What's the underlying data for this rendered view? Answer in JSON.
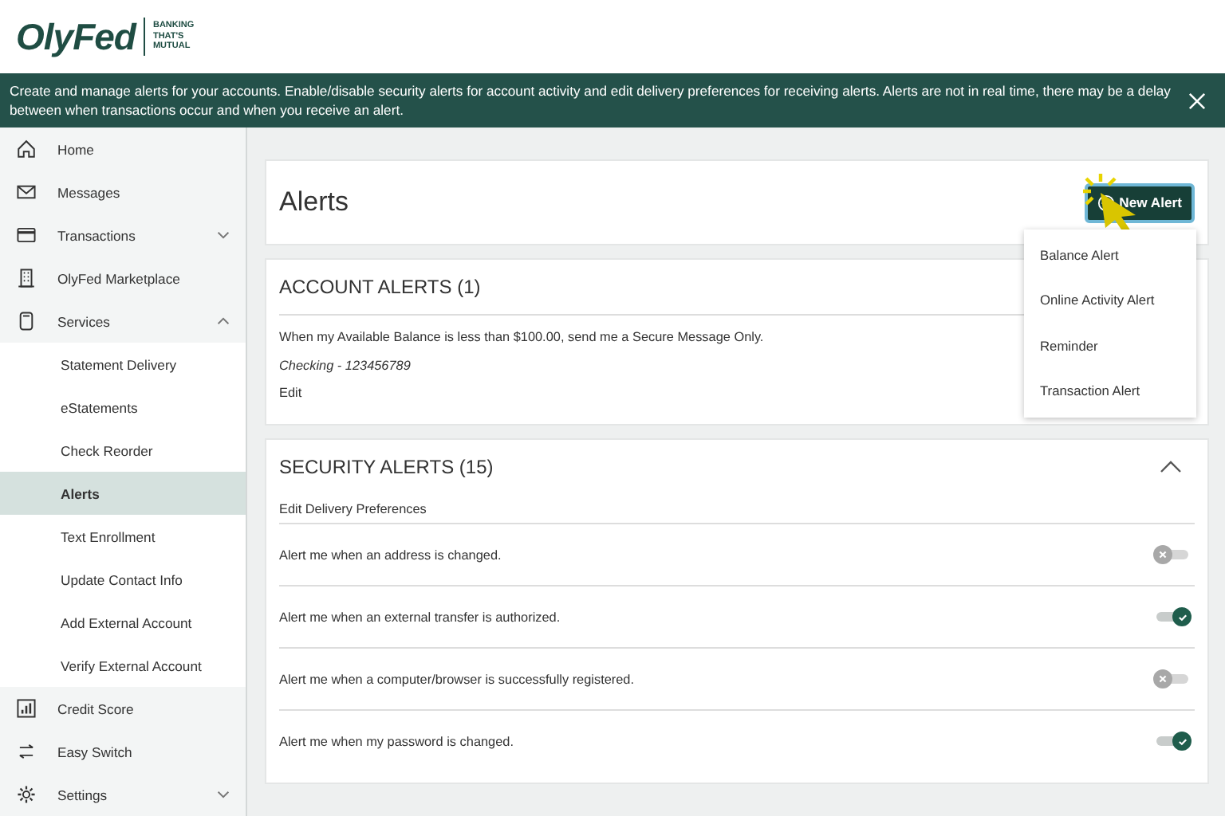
{
  "logo": {
    "name": "OlyFed",
    "tagline": [
      "BANKING",
      "THAT'S",
      "MUTUAL"
    ]
  },
  "banner": {
    "text": "Create and manage alerts for your accounts. Enable/disable security alerts for account activity and edit delivery preferences for receiving alerts. Alerts are not in real time, there may be a delay between when transactions occur and when you receive an alert."
  },
  "sidebar": {
    "items": [
      {
        "label": "Home",
        "selected": false
      },
      {
        "label": "Messages",
        "selected": false
      },
      {
        "label": "Transactions",
        "selected": false,
        "expanded": false
      },
      {
        "label": "OlyFed Marketplace",
        "selected": false
      },
      {
        "label": "Services",
        "selected": false,
        "expanded": true,
        "children": [
          {
            "label": "Statement Delivery",
            "selected": false
          },
          {
            "label": "eStatements",
            "selected": false
          },
          {
            "label": "Check Reorder",
            "selected": false
          },
          {
            "label": "Alerts",
            "selected": true
          },
          {
            "label": "Text Enrollment",
            "selected": false
          },
          {
            "label": "Update Contact Info",
            "selected": false
          },
          {
            "label": "Add External Account",
            "selected": false
          },
          {
            "label": "Verify External Account",
            "selected": false
          }
        ]
      },
      {
        "label": "Credit Score",
        "selected": false
      },
      {
        "label": "Easy Switch",
        "selected": false
      },
      {
        "label": "Settings",
        "selected": false,
        "expanded": false
      }
    ]
  },
  "page": {
    "title": "Alerts",
    "new_button": "New Alert",
    "menu": [
      "Balance Alert",
      "Online Activity Alert",
      "Reminder",
      "Transaction Alert"
    ]
  },
  "account_alerts": {
    "title": "ACCOUNT ALERTS (1)",
    "alerts": [
      {
        "text": "When my Available Balance is less than $100.00, send me a Secure Message Only.",
        "account": "Checking - 123456789",
        "edit": "Edit"
      }
    ]
  },
  "security_alerts": {
    "title": "SECURITY ALERTS (15)",
    "expanded": true,
    "preferences_link": "Edit Delivery Preferences",
    "rows": [
      {
        "label": "Alert me when an address is changed.",
        "on": false
      },
      {
        "label": "Alert me when an external transfer is authorized.",
        "on": true
      },
      {
        "label": "Alert me when a computer/browser is successfully registered.",
        "on": false
      },
      {
        "label": "Alert me when my password is changed.",
        "on": true
      }
    ]
  }
}
